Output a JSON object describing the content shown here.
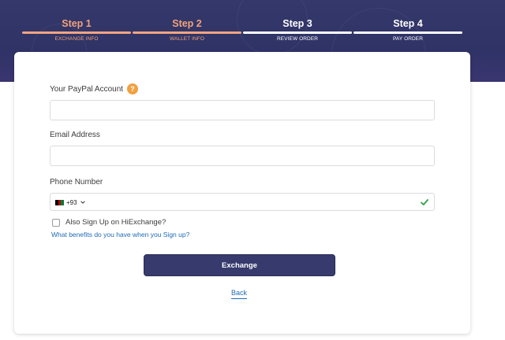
{
  "steps": [
    {
      "number": "Step 1",
      "label": "EXCHANGE INFO",
      "state": "complete"
    },
    {
      "number": "Step 2",
      "label": "WALLET INFO",
      "state": "complete"
    },
    {
      "number": "Step 3",
      "label": "REVIEW ORDER",
      "state": "pending"
    },
    {
      "number": "Step 4",
      "label": "PAY ORDER",
      "state": "pending"
    }
  ],
  "form": {
    "paypal_label": "Your PayPal Account",
    "paypal_help": "?",
    "paypal_value": "",
    "email_label": "Email Address",
    "email_value": "",
    "phone_label": "Phone Number",
    "phone_country_code": "+93",
    "phone_country_flag": "afghanistan-flag",
    "phone_value": "",
    "phone_valid_icon": "checkmark-icon",
    "signup_checkbox_label": "Also Sign Up on HiExchange?",
    "signup_checked": false,
    "benefits_link": "What benefits do you have when you Sign up?",
    "submit_label": "Exchange",
    "back_label": "Back"
  },
  "colors": {
    "header_bg": "#2f3366",
    "step_complete": "#f0a482",
    "step_pending": "#ffffff",
    "primary_button": "#363a6c",
    "link": "#1f6bb5",
    "help_badge": "#f0a040",
    "valid": "#2ea043"
  }
}
